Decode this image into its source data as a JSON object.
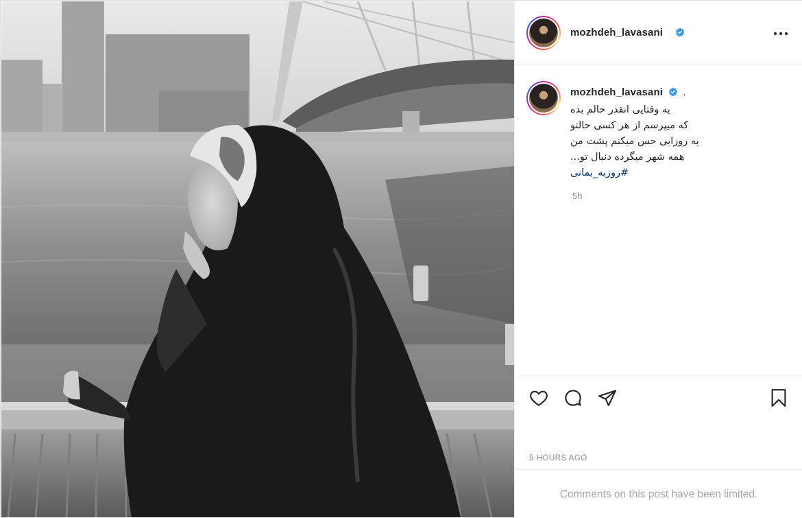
{
  "post": {
    "username": "mozhdeh_lavasani",
    "verified": true,
    "more_icon": "more-horizontal-icon",
    "caption": {
      "trailing_dot": ".",
      "lines": [
        "یه وقتایی انقدر حالم بده",
        "که میپرسم از هر کسی حالتو",
        "یه روزایی حس میکنم پشت من",
        "همه شهر میگرده دنبال تو..."
      ],
      "hashtag": "#روزبه_بمانی",
      "relative_time": "5h"
    },
    "actions": {
      "like_icon": "heart-icon",
      "comment_icon": "comment-icon",
      "share_icon": "share-icon",
      "save_icon": "bookmark-icon"
    },
    "timestamp": "5 HOURS AGO",
    "comments_limited": "Comments on this post have been limited."
  },
  "colors": {
    "text": "#262626",
    "secondary": "#8e8e8e",
    "hashtag": "#00376b",
    "verified": "#3897f0",
    "border": "#efefef"
  }
}
